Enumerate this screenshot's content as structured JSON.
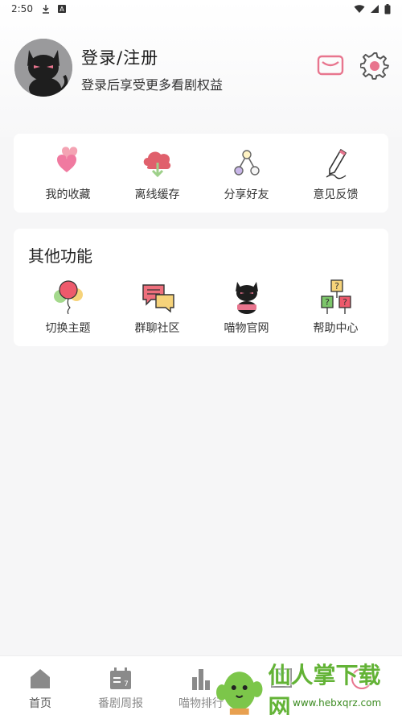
{
  "status_bar": {
    "time": "2:50"
  },
  "header": {
    "login_title": "登录/注册",
    "login_subtitle": "登录后享受更多看剧权益",
    "mail_icon": "mail-icon",
    "settings_icon": "gear-icon"
  },
  "quick_actions": [
    {
      "label": "我的收藏",
      "icon": "hearts-icon"
    },
    {
      "label": "离线缓存",
      "icon": "cloud-download-icon"
    },
    {
      "label": "分享好友",
      "icon": "share-nodes-icon"
    },
    {
      "label": "意见反馈",
      "icon": "pen-feedback-icon"
    }
  ],
  "other_functions": {
    "title": "其他功能",
    "items": [
      {
        "label": "切换主题",
        "icon": "balloons-icon"
      },
      {
        "label": "群聊社区",
        "icon": "chat-bubbles-icon"
      },
      {
        "label": "喵物官网",
        "icon": "black-cat-icon"
      },
      {
        "label": "帮助中心",
        "icon": "question-signs-icon"
      }
    ]
  },
  "bottom_nav": [
    {
      "label": "首页",
      "icon": "home-icon"
    },
    {
      "label": "番剧周报",
      "icon": "calendar-icon"
    },
    {
      "label": "喵物排行",
      "icon": "bar-chart-icon"
    },
    {
      "label": "",
      "icon": "download-icon"
    },
    {
      "label": "",
      "icon": "me-icon"
    }
  ],
  "watermark": {
    "text": "仙人掌下载网",
    "url": "www.hebxqrz.com"
  },
  "colors": {
    "accent_pink": "#e8758e",
    "background": "#f6f6f7",
    "nav_gray": "#8a8a8a"
  }
}
